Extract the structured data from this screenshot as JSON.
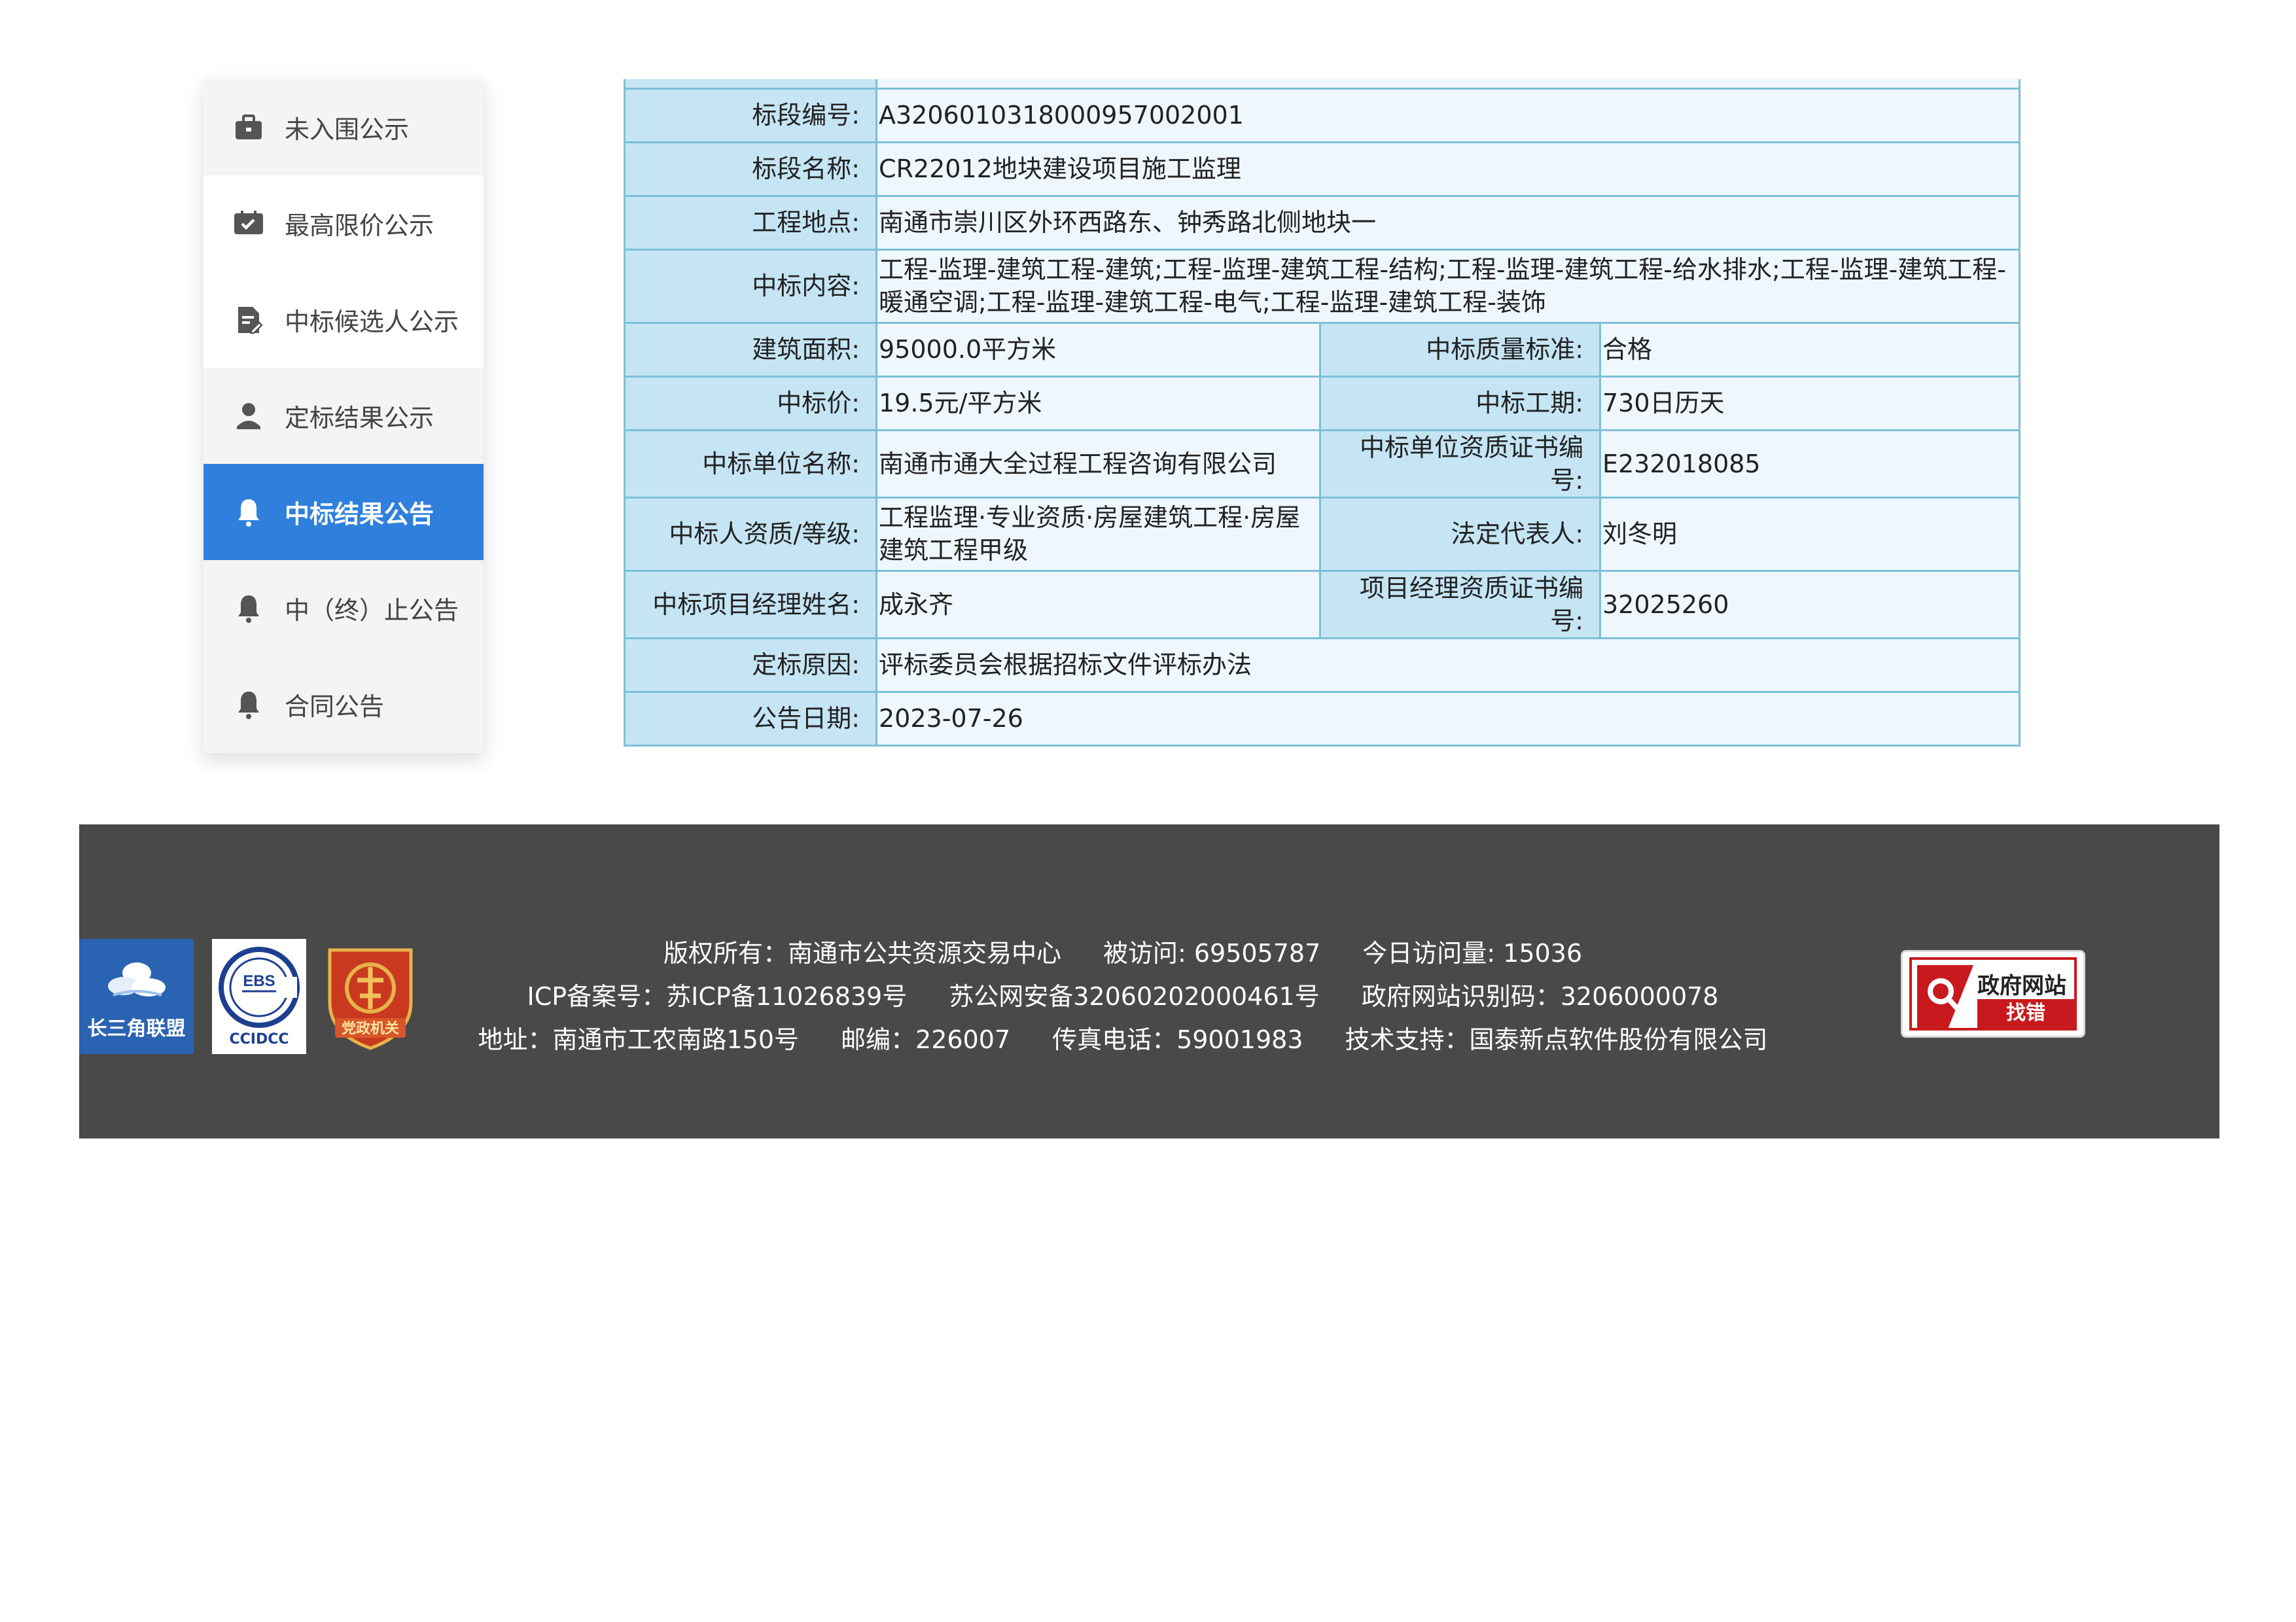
{
  "sidebar": {
    "items": [
      {
        "label": "未入围公示",
        "icon": "briefcase-icon"
      },
      {
        "label": "最高限价公示",
        "icon": "ticket-check-icon"
      },
      {
        "label": "中标候选人公示",
        "icon": "document-edit-icon"
      },
      {
        "label": "定标结果公示",
        "icon": "person-icon"
      },
      {
        "label": "中标结果公告",
        "icon": "bell-icon",
        "active": true
      },
      {
        "label": "中（终）止公告",
        "icon": "bell-icon"
      },
      {
        "label": "合同公告",
        "icon": "bell-icon"
      }
    ],
    "active_color": "#2f7fdc"
  },
  "details": {
    "section_code_label": "标段编号:",
    "section_code": "A3206010318000957002001",
    "section_name_label": "标段名称:",
    "section_name": "CR22012地块建设项目施工监理",
    "location_label": "工程地点:",
    "location": "南通市崇川区外环西路东、钟秀路北侧地块一",
    "content_label": "中标内容:",
    "content": "工程-监理-建筑工程-建筑;工程-监理-建筑工程-结构;工程-监理-建筑工程-给水排水;工程-监理-建筑工程-暖通空调;工程-监理-建筑工程-电气;工程-监理-建筑工程-装饰",
    "area_label": "建筑面积:",
    "area": "95000.0平方米",
    "quality_label": "中标质量标准:",
    "quality": "合格",
    "price_label": "中标价:",
    "price": "19.5元/平方米",
    "period_label": "中标工期:",
    "period": "730日历天",
    "winner_label": "中标单位名称:",
    "winner": "南通市通大全过程工程咨询有限公司",
    "cert_no_label": "中标单位资质证书编号:",
    "cert_no": "E232018085",
    "qualification_label": "中标人资质/等级:",
    "qualification": "工程监理·专业资质·房屋建筑工程·房屋建筑工程甲级",
    "legal_rep_label": "法定代表人:",
    "legal_rep": "刘冬明",
    "pm_name_label": "中标项目经理姓名:",
    "pm_name": "成永齐",
    "pm_cert_label": "项目经理资质证书编号:",
    "pm_cert": "32025260",
    "reason_label": "定标原因:",
    "reason": "评标委员会根据招标文件评标办法",
    "date_label": "公告日期:",
    "date": "2023-07-26"
  },
  "footer": {
    "logos": {
      "yrd": "长三角联盟",
      "ccidcc_mark": "EBS",
      "ccidcc": "CCIDCC",
      "party": "党政机关"
    },
    "copyright": "版权所有：南通市公共资源交易中心",
    "visits": "被访问: 69505787",
    "today_visits": "今日访问量: 15036",
    "icp": "ICP备案号：苏ICP备11026839号",
    "police": "苏公网安备32060202000461号",
    "site_code": "政府网站识别码：3206000078",
    "address": "地址：南通市工农南路150号",
    "postcode": "邮编：226007",
    "fax": "传真电话：59001983",
    "support": "技术支持：国泰新点软件股份有限公司",
    "gov_badge_title": "政府网站",
    "gov_badge_action": "找错"
  }
}
